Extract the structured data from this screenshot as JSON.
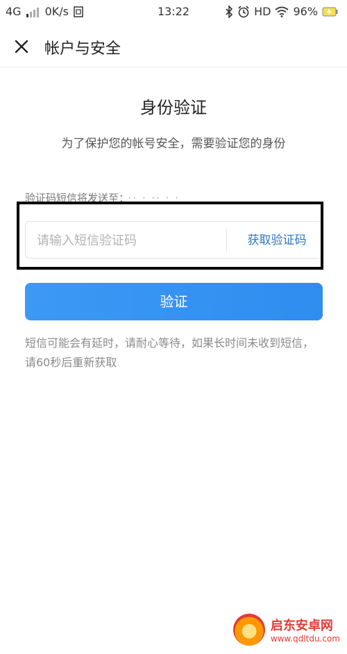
{
  "status_bar": {
    "network": "4G",
    "speed": "0K/s",
    "time": "13:22",
    "hd": "HD",
    "battery": "96%"
  },
  "header": {
    "title": "帐户与安全",
    "close_icon": "close-icon"
  },
  "main": {
    "heading": "身份验证",
    "subtitle": "为了保护您的帐号安全，需要验证您的身份",
    "sent_to_label": "验证码短信将发送至：",
    "sent_to_number": "·· · ·· · ·",
    "code_placeholder": "请输入短信验证码",
    "code_value": "",
    "get_code_label": "获取验证码",
    "verify_label": "验证",
    "hint": "短信可能会有延时，请耐心等待，如果长时间未收到短信，请60秒后重新获取"
  },
  "watermark": {
    "title": "启东安卓网",
    "url": "www.qdltdu.com"
  },
  "colors": {
    "accent": "#2f8df0",
    "link": "#2b76c4",
    "highlight_box": "#000000"
  }
}
